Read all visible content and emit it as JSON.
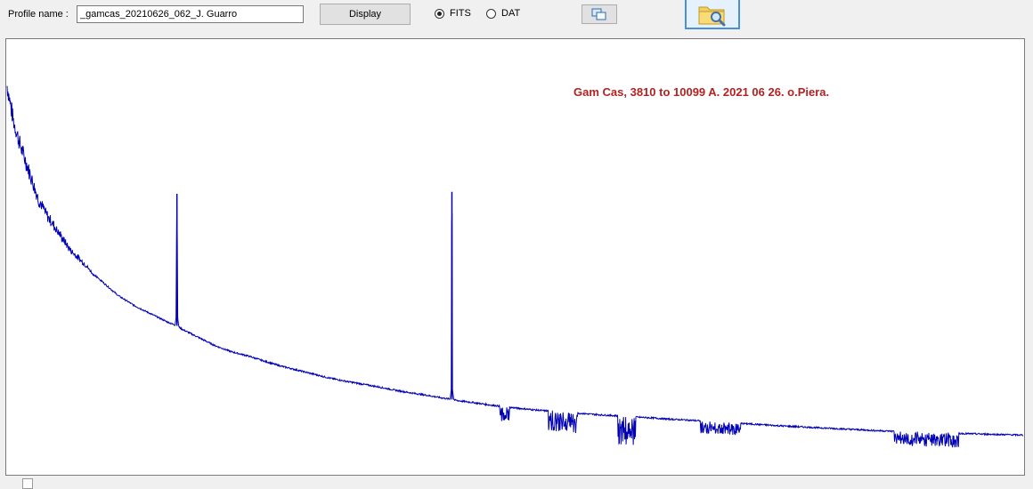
{
  "toolbar": {
    "profile_label": "Profile name :",
    "profile_value": "_gamcas_20210626_062_J. Guarro",
    "display_label": "Display",
    "radio_fits_label": "FITS",
    "radio_dat_label": "DAT",
    "selected_format": "FITS",
    "copy_icon": "copy-window-icon",
    "open_icon": "folder-search-icon"
  },
  "plot": {
    "annotation": "Gam Cas, 3810 to 10099 A. 2021 06  26. o.Piera.",
    "line_color": "#0000b4",
    "annotation_color": "#b22222"
  },
  "chart_data": {
    "type": "line",
    "title": "",
    "annotation": "Gam Cas, 3810 to 10099 A. 2021 06  26. o.Piera.",
    "x_range": [
      3810,
      10099
    ],
    "x_unit": "A",
    "y_range": [
      0,
      1
    ],
    "axes_shown": false,
    "grid": false,
    "series": [
      {
        "color": "#0000b4",
        "x": [
          3810,
          3850,
          3900,
          3960,
          4000,
          4050,
          4101,
          4150,
          4200,
          4250,
          4300,
          4340,
          4400,
          4471,
          4500,
          4600,
          4700,
          4800,
          4861,
          4900,
          5000,
          5100,
          5200,
          5300,
          5400,
          5500,
          5600,
          5700,
          5800,
          5900,
          6000,
          6100,
          6200,
          6300,
          6400,
          6500,
          6563,
          6600,
          6700,
          6800,
          6870,
          6900,
          7000,
          7100,
          7200,
          7300,
          7400,
          7500,
          7600,
          7700,
          7800,
          7900,
          8000,
          8200,
          8400,
          8600,
          8800,
          9000,
          9200,
          9400,
          9600,
          9800,
          10000,
          10099
        ],
        "y": [
          0.95,
          0.86,
          0.79,
          0.72,
          0.67,
          0.63,
          0.6,
          0.57,
          0.54,
          0.52,
          0.5,
          0.48,
          0.46,
          0.435,
          0.425,
          0.4,
          0.38,
          0.36,
          0.35,
          0.34,
          0.32,
          0.3,
          0.285,
          0.275,
          0.262,
          0.25,
          0.24,
          0.23,
          0.22,
          0.212,
          0.205,
          0.198,
          0.19,
          0.183,
          0.177,
          0.17,
          0.166,
          0.163,
          0.158,
          0.152,
          0.149,
          0.147,
          0.143,
          0.139,
          0.136,
          0.133,
          0.13,
          0.127,
          0.125,
          0.122,
          0.12,
          0.117,
          0.115,
          0.11,
          0.105,
          0.1,
          0.096,
          0.092,
          0.088,
          0.085,
          0.082,
          0.08,
          0.078,
          0.077
        ],
        "emission_peaks": [
          {
            "x": 4861,
            "y": 0.68
          },
          {
            "x": 6563,
            "y": 0.685
          }
        ],
        "absorption_bands": [
          {
            "x_start": 6860,
            "x_end": 6920,
            "depth": 0.04
          },
          {
            "x_start": 7160,
            "x_end": 7340,
            "depth": 0.05
          },
          {
            "x_start": 7590,
            "x_end": 7700,
            "depth": 0.07
          },
          {
            "x_start": 8100,
            "x_end": 8350,
            "depth": 0.03
          },
          {
            "x_start": 9300,
            "x_end": 9700,
            "depth": 0.035
          }
        ]
      }
    ]
  }
}
